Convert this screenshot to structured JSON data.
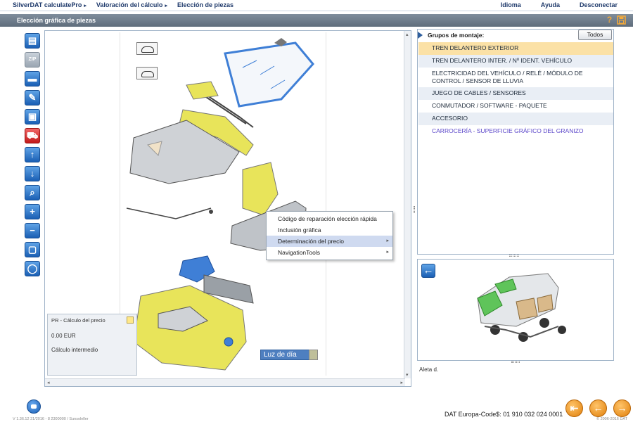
{
  "nav": {
    "crumbs": [
      {
        "label": "SilverDAT calculatePro",
        "arrow": "▸"
      },
      {
        "label": "Valoración del cálculo",
        "arrow": "▸"
      },
      {
        "label": "Elección de piezas",
        "arrow": ""
      }
    ],
    "links": [
      "Idioma",
      "Ayuda",
      "Desconectar"
    ]
  },
  "window": {
    "title": "Elección gráfica de piezas",
    "help_icon": "?"
  },
  "toolbar": {
    "tools": [
      {
        "name": "document-icon",
        "glyph": "▤",
        "style": "blue"
      },
      {
        "name": "zip-icon",
        "glyph": "ZIP",
        "style": "grey"
      },
      {
        "name": "car-icon",
        "glyph": "▬",
        "style": "blue"
      },
      {
        "name": "pencil-icon",
        "glyph": "✎",
        "style": "blue"
      },
      {
        "name": "image-icon",
        "glyph": "▣",
        "style": "blue"
      },
      {
        "name": "car-red-icon",
        "glyph": "⛟",
        "style": "red"
      },
      {
        "name": "arrow-up-icon",
        "glyph": "↑",
        "style": "blue"
      },
      {
        "name": "arrow-down-icon",
        "glyph": "↓",
        "style": "blue"
      },
      {
        "name": "zoom-icon",
        "glyph": "⌕",
        "style": "blue"
      },
      {
        "name": "zoom-in-icon",
        "glyph": "+",
        "style": "blue"
      },
      {
        "name": "zoom-out-icon",
        "glyph": "−",
        "style": "blue"
      },
      {
        "name": "fit-window-icon",
        "glyph": "▢",
        "style": "blue"
      },
      {
        "name": "lasso-icon",
        "glyph": "◯",
        "style": "blue"
      }
    ]
  },
  "graphic": {
    "scroll_left": "◂",
    "scroll_right": "▸",
    "scroll_up": "▴",
    "scroll_down": "▾",
    "daylight_button": "Luz de día"
  },
  "price": {
    "title": "PR - Cálculo del precio",
    "value": "0.00 EUR",
    "subtitle": "Cálculo intermedio"
  },
  "context_menu": {
    "items": [
      {
        "label": "Código de reparación elección rápida",
        "submenu": false,
        "selected": false
      },
      {
        "label": "Inclusión gráfica",
        "submenu": false,
        "selected": false
      },
      {
        "label": "Determinación del precio",
        "submenu": true,
        "selected": true
      },
      {
        "label": "NavigationTools",
        "submenu": true,
        "selected": false
      }
    ],
    "submenu_glyph": "▸"
  },
  "groups": {
    "header": "Grupos de montaje:",
    "all_button": "Todos",
    "items": [
      "TREN DELANTERO EXTERIOR",
      "TREN DELANTERO INTER. / Nº IDENT. VEHÍCULO",
      "ELECTRICIDAD DEL VEHÍCULO / RELÉ / MÓDULO DE CONTROL / SENSOR DE LLUVIA",
      "JUEGO DE CABLES / SENSORES",
      "CONMUTADOR / SOFTWARE - PAQUETE",
      "ACCESORIO",
      "CARROCERÍA - SUPERFICIE GRÁFICO DEL GRANIZO"
    ]
  },
  "overview": {
    "back_glyph": "←",
    "caption": "Aleta d."
  },
  "footer": {
    "version": "V 1.36.12   21/2016 - 8   2300000 / Sunsoleller",
    "code": "DAT Europa-Code$: 01 910 032 024 0001",
    "nav_glyphs": [
      "⇤",
      "←",
      "→"
    ],
    "copyright": "© 2006-2016 DAT"
  },
  "colors": {
    "accent_blue": "#1a5fb4",
    "title_bar": "#6b7988",
    "selected_row": "#fbe1a6",
    "part_yellow": "#e8e45a",
    "part_blue": "#3f7fd6",
    "nav_orange": "#e07f0a",
    "link_purple": "#5a45c9"
  }
}
